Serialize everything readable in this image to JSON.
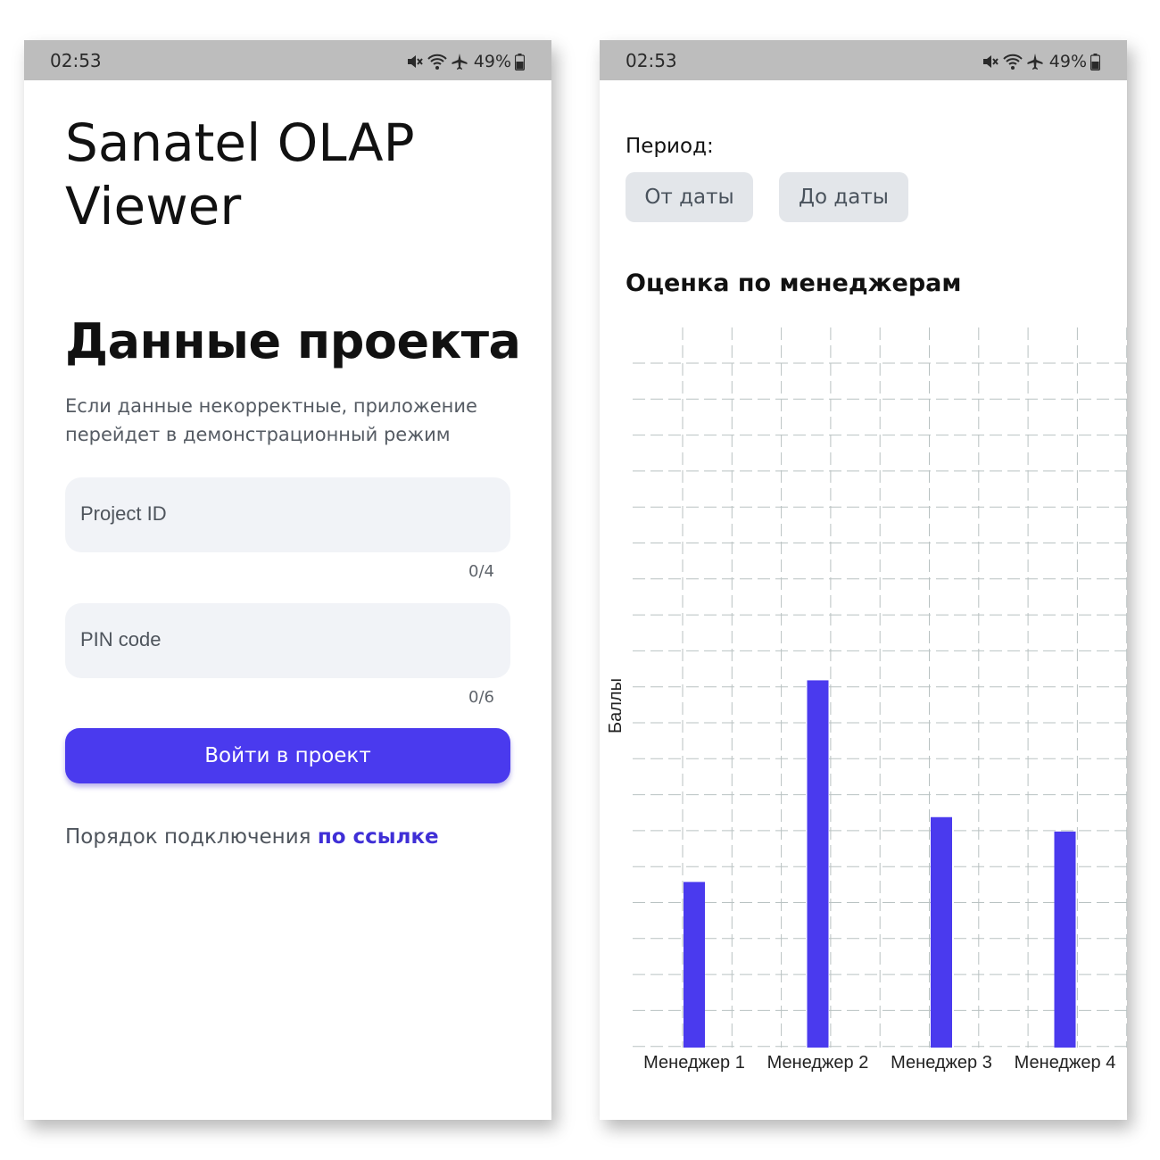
{
  "status_bar": {
    "time": "02:53",
    "battery": "49%"
  },
  "login_screen": {
    "app_title": "Sanatel OLAP Viewer",
    "section_title": "Данные проекта",
    "description": "Если данные некорректные, приложение перейдет в демонстрационный режим",
    "project_id": {
      "placeholder": "Project ID",
      "counter": "0/4"
    },
    "pin_code": {
      "placeholder": "PIN code",
      "counter": "0/6"
    },
    "submit_label": "Войти в проект",
    "footer_text": "Порядок подключения",
    "footer_link": "по ссылке"
  },
  "report_screen": {
    "period_label": "Период:",
    "from_date_label": "От даты",
    "to_date_label": "До даты",
    "chart_title": "Оценка по менеджерам"
  },
  "colors": {
    "accent": "#4a3aee",
    "bar": "#4a3aee",
    "status_bar": "#bdbdbd",
    "input_bg": "#f1f3f7",
    "chip_bg": "#e3e6ea"
  },
  "icons": [
    "mute-icon",
    "wifi-icon",
    "airplane-icon",
    "battery-icon"
  ],
  "chart_data": {
    "type": "bar",
    "categories": [
      "Менеджер 1",
      "Менеджер 2",
      "Менеджер 3",
      "Менеджер 4"
    ],
    "values": [
      23,
      51,
      32,
      30
    ],
    "ylabel": "Баллы",
    "ylim": [
      0,
      100
    ],
    "grid": true,
    "legend": "none"
  }
}
